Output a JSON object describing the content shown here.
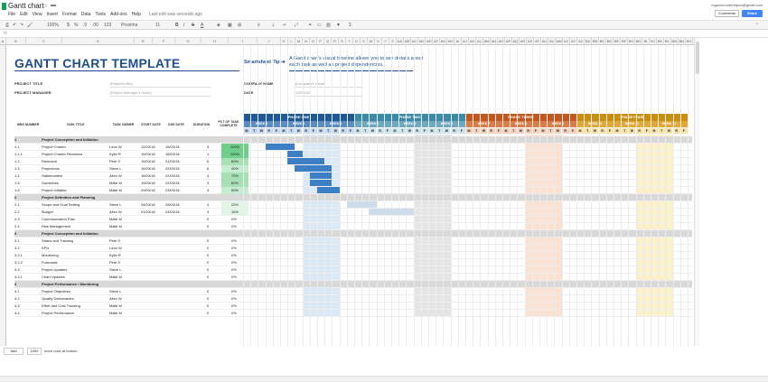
{
  "app": {
    "title": "Gantt chart",
    "last_edit": "Last edit was seconds ago",
    "user_email": "mgsummoderetpea@gmail.com",
    "comments_label": "Comments",
    "share_label": "Share"
  },
  "menu": [
    "File",
    "Edit",
    "View",
    "Insert",
    "Format",
    "Data",
    "Tools",
    "Add-ons",
    "Help"
  ],
  "toolbar": {
    "zoom": "100%",
    "currency": "$",
    "percent": "%",
    "decimals_dec": ".0",
    "decimals_inc": ".00",
    "format_more": "123",
    "font": "Proxima",
    "font_size": "11",
    "bold": "B",
    "italic": "I",
    "strike": "S",
    "text_color": "A",
    "sum": "Σ"
  },
  "formula_bar": {
    "fx": "fx"
  },
  "columns": [
    "A",
    "B",
    "C",
    "D",
    "E",
    "F",
    "G",
    "H",
    "I",
    "J",
    "K",
    "L",
    "M",
    "N",
    "O",
    "P",
    "Q",
    "R",
    "S",
    "T",
    "U",
    "V",
    "W",
    "X",
    "Y",
    "Z",
    "AA",
    "AB",
    "AC",
    "AD",
    "AE",
    "AF",
    "AG",
    "AH",
    "AI",
    "AJ",
    "AK",
    "AL",
    "AM",
    "AN",
    "AO",
    "AP",
    "AQ",
    "AR",
    "AS",
    "AT",
    "AU",
    "AV",
    "AW",
    "AX",
    "AY",
    "AZ",
    "BA",
    "BB",
    "BC",
    "BD",
    "BE",
    "BF",
    "BG",
    "BH",
    "BI",
    "BJ",
    "BK",
    "BL",
    "BM",
    "BN",
    "BO",
    "BP",
    "BQ",
    "BR"
  ],
  "sheet": {
    "title": "GANTT CHART TEMPLATE",
    "tip_label": "Smartsheet Tip ➔",
    "tip_text": "A Gantt chart's visual timeline allows you to see details about each task as well as project dependencies.",
    "project_title_label": "PROJECT TITLE",
    "project_title_value": "[Project's title]",
    "project_manager_label": "PROJECT MANAGER",
    "project_manager_value": "[Project Manager's name]",
    "company_label": "COMPANY NAME",
    "company_value": "[Company's name]",
    "date_label": "DATE",
    "date_value": "12/03/18"
  },
  "table_headers": {
    "wbs": "WBS NUMBER",
    "task": "TASK TITLE",
    "owner": "TASK OWNER",
    "start": "START DATE",
    "due": "DUE DATE",
    "duration": "DURATION",
    "pct": "PCT OF TASK COMPLETE"
  },
  "phases": [
    {
      "label": "PHASE ONE",
      "color": "#1f5a96",
      "light": "#5b8cc2",
      "weeks": [
        "WEEK 1",
        "WEEK 2",
        "WEEK 3"
      ]
    },
    {
      "label": "PHASE TWO",
      "color": "#3d8aa8",
      "light": "#6ea9c0",
      "weeks": [
        "WEEK 4",
        "WEEK 5",
        "WEEK 6"
      ]
    },
    {
      "label": "PHASE THREE",
      "color": "#c0581f",
      "light": "#d97e4a",
      "weeks": [
        "WEEK 7",
        "WEEK 8",
        "WEEK 9"
      ]
    },
    {
      "label": "PHASE FOUR",
      "color": "#c98f11",
      "light": "#e0aa3a",
      "weeks": [
        "WEEK 10",
        "WEEK 11",
        "WEEK 12"
      ]
    }
  ],
  "day_letters": [
    "M",
    "T",
    "W",
    "R",
    "F",
    "S",
    "S"
  ],
  "rows": [
    {
      "wbs": "1",
      "title": "Project Conception and Initiation",
      "phase": true
    },
    {
      "wbs": "1.1",
      "title": "Project Charter",
      "owner": "Leon W",
      "start": "12/03/18",
      "due": "15/03/18",
      "dur": "3",
      "pct": "100%",
      "bar_start": 3,
      "bar_len": 4
    },
    {
      "wbs": "1.1.1",
      "title": "Project Charter Revisions",
      "owner": "Kylie R",
      "start": "15/03/18",
      "due": "16/03/18",
      "dur": "1",
      "pct": "100%",
      "bar_start": 6,
      "bar_len": 2
    },
    {
      "wbs": "1.2",
      "title": "Research",
      "owner": "Pete S",
      "start": "15/03/18",
      "due": "21/03/18",
      "dur": "6",
      "pct": "60%",
      "bar_start": 6,
      "bar_len": 5
    },
    {
      "wbs": "1.3",
      "title": "Projections",
      "owner": "Steve L",
      "start": "16/03/18",
      "due": "22/03/18",
      "dur": "6",
      "pct": "40%",
      "bar_start": 7,
      "bar_len": 5
    },
    {
      "wbs": "1.4",
      "title": "Stakeholders",
      "owner": "Allen W",
      "start": "18/03/18",
      "due": "22/03/18",
      "dur": "4",
      "pct": "70%",
      "bar_start": 9,
      "bar_len": 3
    },
    {
      "wbs": "1.5",
      "title": "Guidelines",
      "owner": "Malik M",
      "start": "19/03/18",
      "due": "22/03/18",
      "dur": "3",
      "pct": "60%",
      "bar_start": 9,
      "bar_len": 3
    },
    {
      "wbs": "1.6",
      "title": "Project Initiation",
      "owner": "Malik M",
      "start": "20/03/18",
      "due": "23/03/18",
      "dur": "3",
      "pct": "50%",
      "bar_start": 10,
      "bar_len": 3
    },
    {
      "wbs": "2",
      "title": "Project Definition and Planning",
      "phase": true
    },
    {
      "wbs": "2.1",
      "title": "Scope and Goal Setting",
      "owner": "Steve L",
      "start": "24/03/18",
      "due": "28/03/18",
      "dur": "4",
      "pct": "22%",
      "bar_start": 14,
      "bar_len": 4
    },
    {
      "wbs": "2.2",
      "title": "Budget",
      "owner": "Allen W",
      "start": "21/03/18",
      "due": "24/03/18",
      "dur": "3",
      "pct": "16%",
      "bar_start": 17,
      "bar_len": 6
    },
    {
      "wbs": "2.3",
      "title": "Communication Plan",
      "owner": "Malik M",
      "dur": "0",
      "pct": "0%"
    },
    {
      "wbs": "2.4",
      "title": "Risk Management",
      "owner": "Malik M",
      "dur": "0",
      "pct": "0%"
    },
    {
      "wbs": "3",
      "title": "Project Conception and Initiation",
      "phase": true
    },
    {
      "wbs": "3.1",
      "title": "Status and Tracking",
      "owner": "Pete S",
      "dur": "0",
      "pct": "0%"
    },
    {
      "wbs": "3.2",
      "title": "KPIs",
      "owner": "Leon W",
      "dur": "0",
      "pct": "0%"
    },
    {
      "wbs": "3.2.1",
      "title": "Monitoring",
      "owner": "Kylie R",
      "dur": "0",
      "pct": "0%"
    },
    {
      "wbs": "3.2.2",
      "title": "Forecasts",
      "owner": "Pete S",
      "dur": "0",
      "pct": "0%"
    },
    {
      "wbs": "3.3",
      "title": "Project Updates",
      "owner": "Steve L",
      "dur": "0",
      "pct": "0%"
    },
    {
      "wbs": "3.3.1",
      "title": "Chart Updates",
      "owner": "Malik M",
      "dur": "0",
      "pct": "0%"
    },
    {
      "wbs": "4",
      "title": "Project Performance / Monitoring",
      "phase": true
    },
    {
      "wbs": "4.1",
      "title": "Project Objectives",
      "owner": "Steve L",
      "dur": "0",
      "pct": "0%"
    },
    {
      "wbs": "4.2",
      "title": "Quality Deliverables",
      "owner": "Allen W",
      "dur": "0",
      "pct": "0%"
    },
    {
      "wbs": "4.3",
      "title": "Effort and Cost Tracking",
      "owner": "Malik M",
      "dur": "0",
      "pct": "0%"
    },
    {
      "wbs": "4.4",
      "title": "Project Performance",
      "owner": "Malik M",
      "dur": "0",
      "pct": "0%"
    }
  ],
  "footer": {
    "add_label": "Add",
    "rows_value": "1000",
    "rows_text": "more rows at bottom."
  }
}
